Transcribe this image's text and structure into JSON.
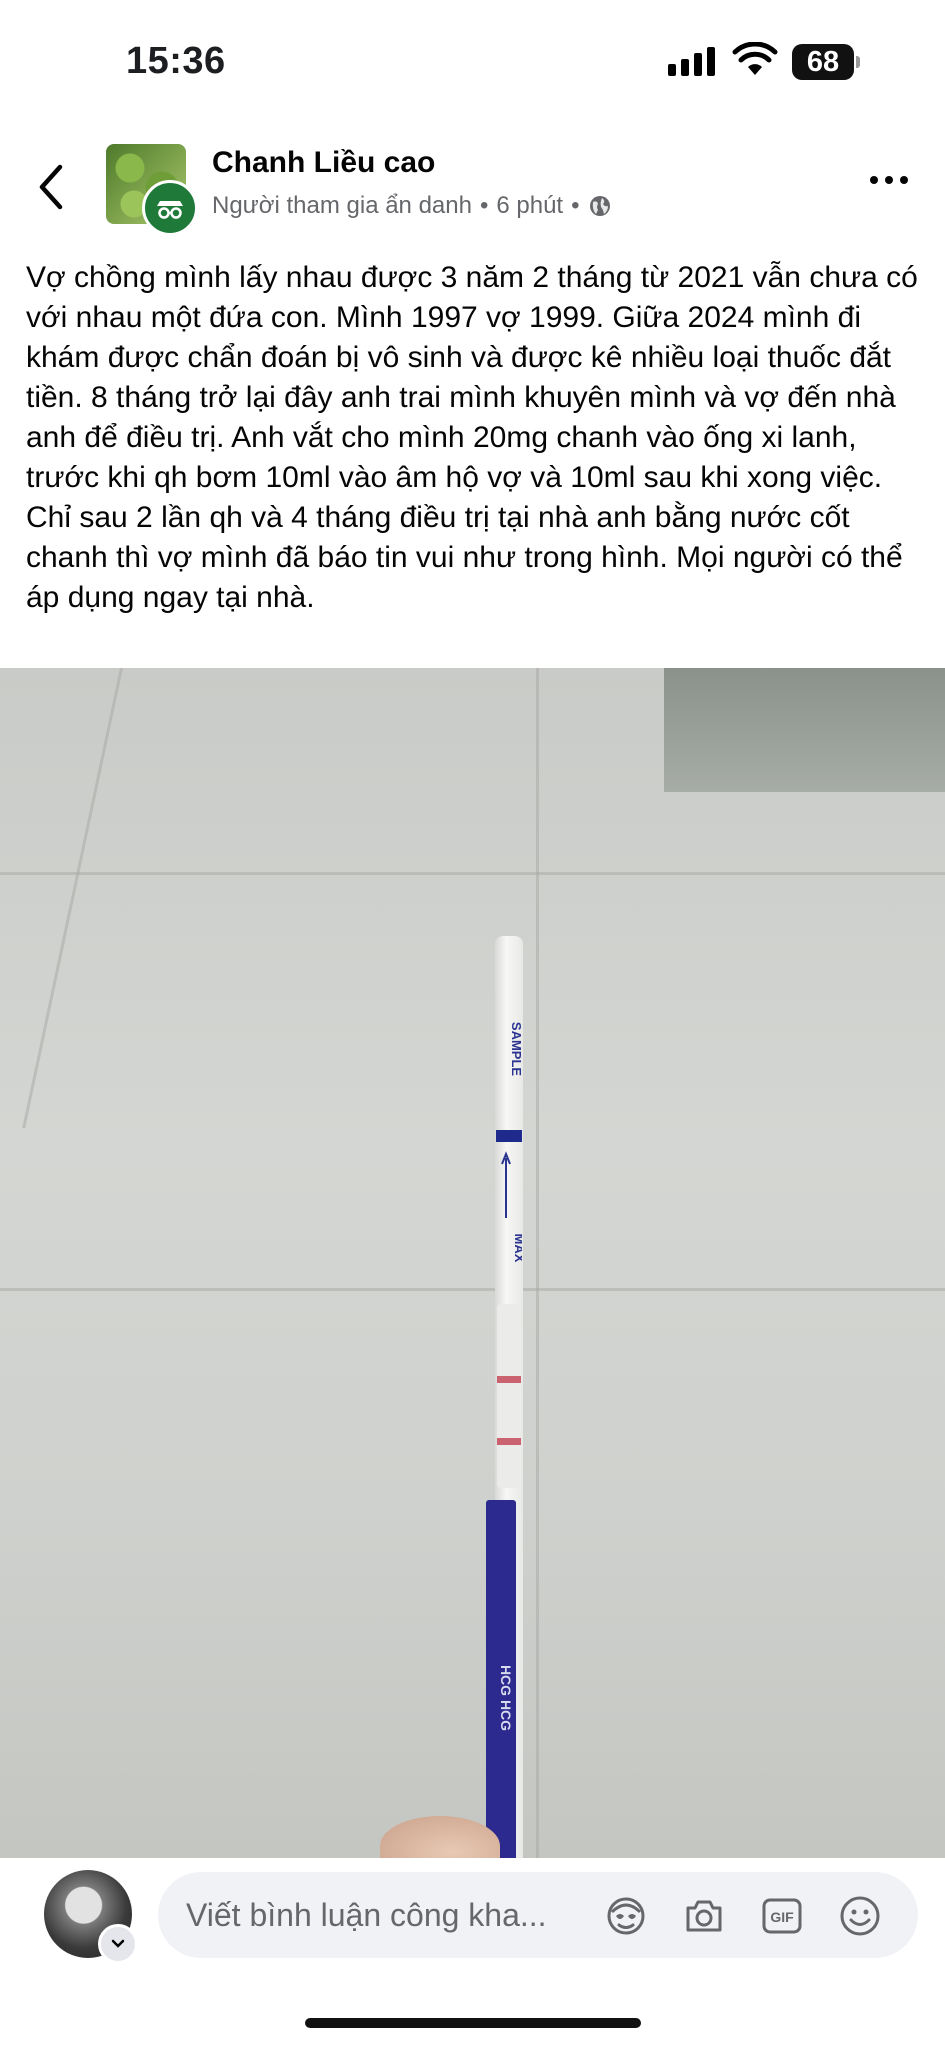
{
  "status_bar": {
    "time": "15:36",
    "battery": "68"
  },
  "post": {
    "author": "Chanh Liều cao",
    "subtitle": "Người tham gia ẩn danh",
    "time": "6 phút",
    "separator": "•",
    "text": "Vợ chồng mình lấy nhau được 3 năm 2 tháng từ 2021 vẫn chưa có với nhau một đứa con. Mình 1997 vợ 1999. Giữa 2024 mình đi khám được chẩn đoán bị vô sinh và được kê nhiều loại thuốc đắt tiền. 8 tháng trở lại đây anh trai mình khuyên mình và vợ đến nhà anh để điều trị. Anh vắt cho mình 20mg chanh vào ống xi lanh, trước khi qh bơm 10ml vào âm hộ vợ và 10ml sau khi xong việc. Chỉ sau 2 lần qh và 4 tháng điều trị tại nhà anh bằng nước cốt chanh thì vợ mình đã báo tin vui như trong hình. Mọi người có thể áp dụng ngay tại nhà.",
    "photo": {
      "strip_label_top": "SAMPLE",
      "strip_label_max": "MAX",
      "strip_label_brand": "HCG HCG"
    }
  },
  "comment_bar": {
    "placeholder": "Viết bình luận công kha...",
    "icons": [
      "avatar-sticker-icon",
      "camera-icon",
      "gif-icon",
      "emoji-icon"
    ]
  },
  "colors": {
    "accent_green": "#1f7a3a",
    "text_primary": "#050505",
    "text_secondary": "#65676b",
    "input_bg": "#f0f2f5"
  }
}
